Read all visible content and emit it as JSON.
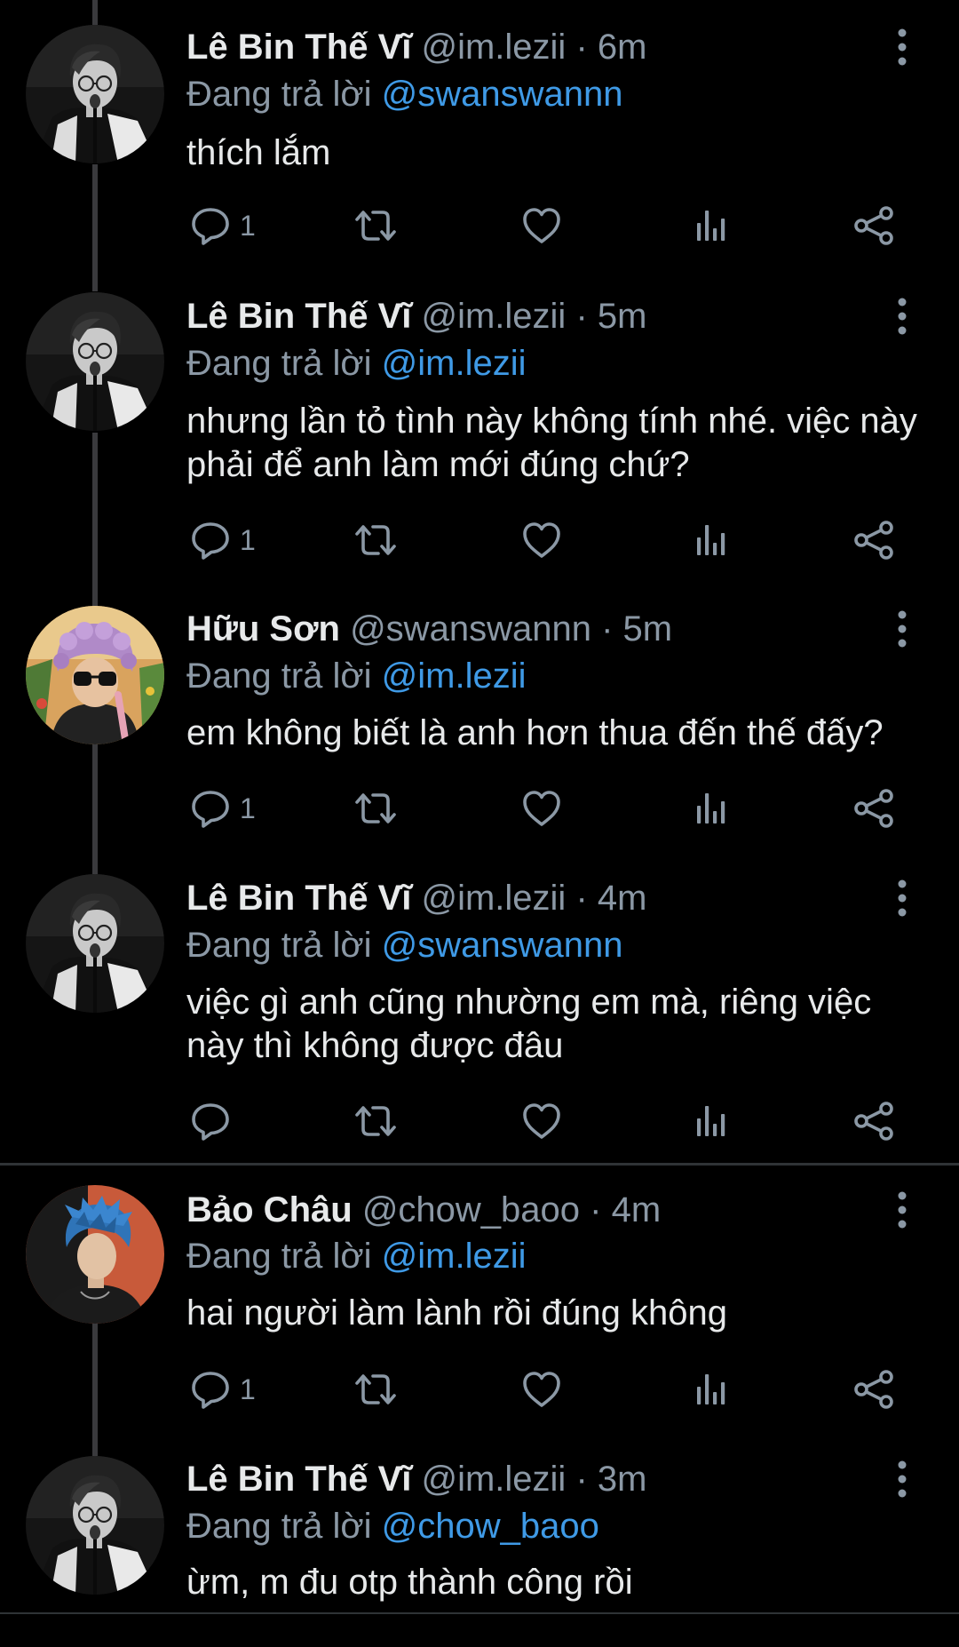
{
  "theme": {
    "background": "#000000",
    "text": "#e7e9ea",
    "muted": "#8b98a5",
    "mention": "#3f9ae6",
    "thread_line": "#3a3a3d",
    "divider": "#2f3336"
  },
  "tweets": [
    {
      "avatar": "avatar-le-bin",
      "name": "Lê Bin Thế Vĩ",
      "handle": "@im.lezii",
      "dot": "·",
      "time": "6m",
      "reply_prefix": "Đang trả lời ",
      "reply_to": "@swanswannn",
      "text": "thích lắm",
      "reply_count": "1"
    },
    {
      "avatar": "avatar-le-bin",
      "name": "Lê Bin Thế Vĩ",
      "handle": "@im.lezii",
      "dot": "·",
      "time": "5m",
      "reply_prefix": "Đang trả lời ",
      "reply_to": "@im.lezii",
      "text": "nhưng lần tỏ tình này không tính nhé. việc này phải để anh làm mới đúng chứ?",
      "reply_count": "1"
    },
    {
      "avatar": "avatar-huu-son",
      "name": "Hữu Sơn",
      "handle": "@swanswannn",
      "dot": "·",
      "time": "5m",
      "reply_prefix": "Đang trả lời ",
      "reply_to": "@im.lezii",
      "text": "em không biết là anh hơn thua đến thế đấy?",
      "reply_count": "1"
    },
    {
      "avatar": "avatar-le-bin",
      "name": "Lê Bin Thế Vĩ",
      "handle": "@im.lezii",
      "dot": "·",
      "time": "4m",
      "reply_prefix": "Đang trả lời ",
      "reply_to": "@swanswannn",
      "text": "việc gì anh cũng nhường em mà, riêng việc này thì không được đâu",
      "reply_count": ""
    },
    {
      "avatar": "avatar-bao-chau",
      "name": "Bảo Châu",
      "handle": "@chow_baoo",
      "dot": "·",
      "time": "4m",
      "reply_prefix": "Đang trả lời ",
      "reply_to": "@im.lezii",
      "text": "hai người làm lành rồi đúng không",
      "reply_count": "1"
    },
    {
      "avatar": "avatar-le-bin",
      "name": "Lê Bin Thế Vĩ",
      "handle": "@im.lezii",
      "dot": "·",
      "time": "3m",
      "reply_prefix": "Đang trả lời ",
      "reply_to": "@chow_baoo",
      "text": "ừm, m đu otp thành công rồi",
      "reply_count": ""
    }
  ]
}
